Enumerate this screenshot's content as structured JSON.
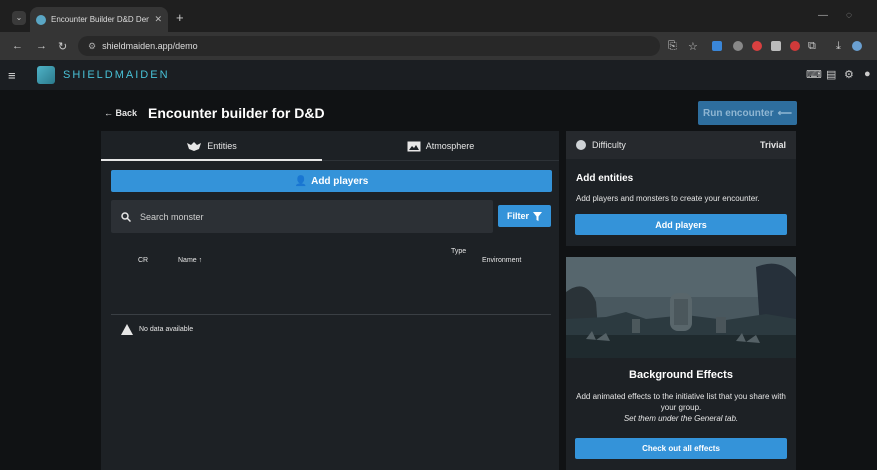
{
  "browser": {
    "tab_title": "Encounter Builder D&D Demo | ",
    "tab_close": "✕",
    "new_tab": "+",
    "url": "shieldmaiden.app/demo"
  },
  "app": {
    "brand": "SHIELDMAIDEN"
  },
  "header": {
    "back_label": "Back",
    "title": "Encounter builder for D&D",
    "run_label": "Run encounter"
  },
  "tabs": [
    {
      "label": "Entities",
      "icon": "monster-icon"
    },
    {
      "label": "Atmosphere",
      "icon": "image-icon"
    }
  ],
  "entities": {
    "add_players_label": "Add players",
    "search_placeholder": "Search monster",
    "filter_label": "Filter",
    "columns": {
      "cr": "CR",
      "name": "Name",
      "type": "Type",
      "environment": "Environment"
    },
    "no_data": "No data available"
  },
  "difficulty": {
    "label": "Difficulty",
    "value": "Trivial"
  },
  "add_entities": {
    "title": "Add entities",
    "text": "Add players and monsters to create your encounter.",
    "button": "Add players"
  },
  "effects": {
    "title": "Background Effects",
    "text": "Add animated effects to the initiative list that you share with your group.",
    "note": "Set them under the General tab.",
    "button": "Check out all effects"
  },
  "colors": {
    "accent": "#3493d9",
    "brand": "#48c0d6",
    "panel": "#1d2125",
    "background": "#101214"
  }
}
